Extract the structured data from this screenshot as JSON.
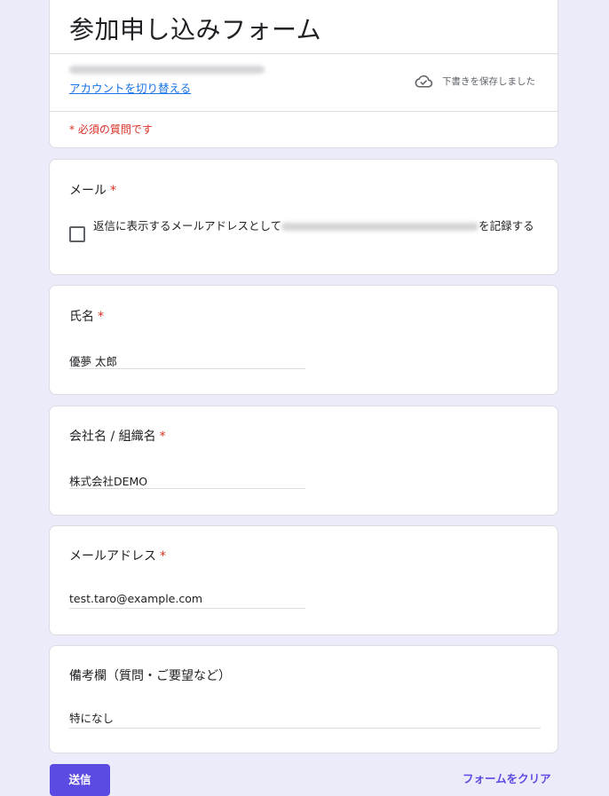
{
  "form": {
    "title": "参加申し込みフォーム",
    "switch_account_link": "アカウントを切り替える",
    "draft_status": "下書きを保存しました",
    "required_note": "* 必須の質問です"
  },
  "questions": {
    "email": {
      "label": "メール",
      "required_mark": "*",
      "checkbox_text_before": "返信に表示するメールアドレスとして",
      "checkbox_text_after": "を記録する",
      "checked": false
    },
    "name": {
      "label": "氏名",
      "required_mark": "*",
      "value": "優夢 太郎"
    },
    "company": {
      "label": "会社名 / 組織名",
      "required_mark": "*",
      "value": "株式会社DEMO"
    },
    "mail_address": {
      "label": "メールアドレス",
      "required_mark": "*",
      "value": "test.taro@example.com"
    },
    "remarks": {
      "label": "備考欄（質問・ご要望など）",
      "value": "特になし"
    }
  },
  "footer": {
    "submit_label": "送信",
    "clear_label": "フォームをクリア"
  },
  "colors": {
    "page_background": "#ecebfa",
    "accent": "#5b4be3",
    "required": "#d93025",
    "link": "#1a73e8"
  },
  "icons": {
    "draft": "cloud-check-icon"
  }
}
